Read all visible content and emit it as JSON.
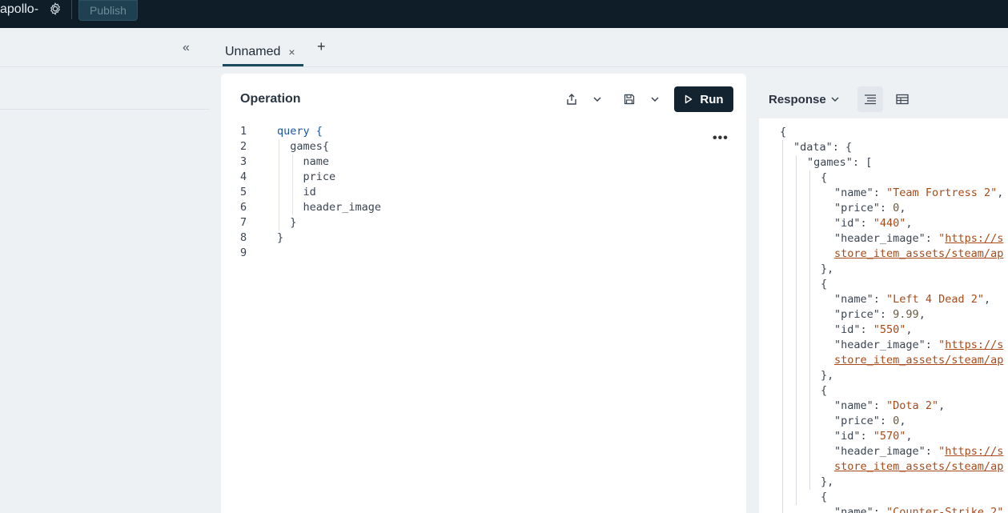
{
  "topbar": {
    "graph_name": "apollo-",
    "publish_label": "Publish"
  },
  "tabs": [
    {
      "label": "Unnamed",
      "close": "×"
    }
  ],
  "tab_add": "+",
  "sidebar": {
    "collapse_glyph": "«"
  },
  "operation": {
    "title": "Operation",
    "run_label": "Run",
    "lines": [
      {
        "n": "1",
        "text": "query {"
      },
      {
        "n": "2",
        "text": "  games{"
      },
      {
        "n": "3",
        "text": "    name"
      },
      {
        "n": "4",
        "text": "    price"
      },
      {
        "n": "5",
        "text": "    id"
      },
      {
        "n": "6",
        "text": "    header_image"
      },
      {
        "n": "7",
        "text": "  }"
      },
      {
        "n": "8",
        "text": "}"
      },
      {
        "n": "9",
        "text": ""
      }
    ],
    "more_glyph": "•••"
  },
  "response": {
    "title": "Response",
    "lines": [
      {
        "indent": 0,
        "parts": [
          {
            "t": "{",
            "c": "p"
          }
        ]
      },
      {
        "indent": 1,
        "parts": [
          {
            "t": "\"data\"",
            "c": "p"
          },
          {
            "t": ": {",
            "c": "p"
          }
        ]
      },
      {
        "indent": 2,
        "parts": [
          {
            "t": "\"games\"",
            "c": "p"
          },
          {
            "t": ": [",
            "c": "p"
          }
        ]
      },
      {
        "indent": 3,
        "parts": [
          {
            "t": "{",
            "c": "p"
          }
        ]
      },
      {
        "indent": 4,
        "parts": [
          {
            "t": "\"name\"",
            "c": "p"
          },
          {
            "t": ": ",
            "c": "p"
          },
          {
            "t": "\"Team Fortress 2\"",
            "c": "s"
          },
          {
            "t": ",",
            "c": "p"
          }
        ]
      },
      {
        "indent": 4,
        "parts": [
          {
            "t": "\"price\"",
            "c": "p"
          },
          {
            "t": ": ",
            "c": "p"
          },
          {
            "t": "0",
            "c": "n"
          },
          {
            "t": ",",
            "c": "p"
          }
        ]
      },
      {
        "indent": 4,
        "parts": [
          {
            "t": "\"id\"",
            "c": "p"
          },
          {
            "t": ": ",
            "c": "p"
          },
          {
            "t": "\"440\"",
            "c": "s"
          },
          {
            "t": ",",
            "c": "p"
          }
        ]
      },
      {
        "indent": 4,
        "parts": [
          {
            "t": "\"header_image\"",
            "c": "p"
          },
          {
            "t": ": ",
            "c": "p"
          },
          {
            "t": "\"",
            "c": "s"
          },
          {
            "t": "https://s",
            "c": "l"
          }
        ]
      },
      {
        "indent": 4,
        "parts": [
          {
            "t": "store_item_assets/steam/ap",
            "c": "l"
          }
        ]
      },
      {
        "indent": 3,
        "parts": [
          {
            "t": "},",
            "c": "p"
          }
        ]
      },
      {
        "indent": 3,
        "parts": [
          {
            "t": "{",
            "c": "p"
          }
        ]
      },
      {
        "indent": 4,
        "parts": [
          {
            "t": "\"name\"",
            "c": "p"
          },
          {
            "t": ": ",
            "c": "p"
          },
          {
            "t": "\"Left 4 Dead 2\"",
            "c": "s"
          },
          {
            "t": ",",
            "c": "p"
          }
        ]
      },
      {
        "indent": 4,
        "parts": [
          {
            "t": "\"price\"",
            "c": "p"
          },
          {
            "t": ": ",
            "c": "p"
          },
          {
            "t": "9.99",
            "c": "n"
          },
          {
            "t": ",",
            "c": "p"
          }
        ]
      },
      {
        "indent": 4,
        "parts": [
          {
            "t": "\"id\"",
            "c": "p"
          },
          {
            "t": ": ",
            "c": "p"
          },
          {
            "t": "\"550\"",
            "c": "s"
          },
          {
            "t": ",",
            "c": "p"
          }
        ]
      },
      {
        "indent": 4,
        "parts": [
          {
            "t": "\"header_image\"",
            "c": "p"
          },
          {
            "t": ": ",
            "c": "p"
          },
          {
            "t": "\"",
            "c": "s"
          },
          {
            "t": "https://s",
            "c": "l"
          }
        ]
      },
      {
        "indent": 4,
        "parts": [
          {
            "t": "store_item_assets/steam/ap",
            "c": "l"
          }
        ]
      },
      {
        "indent": 3,
        "parts": [
          {
            "t": "},",
            "c": "p"
          }
        ]
      },
      {
        "indent": 3,
        "parts": [
          {
            "t": "{",
            "c": "p"
          }
        ]
      },
      {
        "indent": 4,
        "parts": [
          {
            "t": "\"name\"",
            "c": "p"
          },
          {
            "t": ": ",
            "c": "p"
          },
          {
            "t": "\"Dota 2\"",
            "c": "s"
          },
          {
            "t": ",",
            "c": "p"
          }
        ]
      },
      {
        "indent": 4,
        "parts": [
          {
            "t": "\"price\"",
            "c": "p"
          },
          {
            "t": ": ",
            "c": "p"
          },
          {
            "t": "0",
            "c": "n"
          },
          {
            "t": ",",
            "c": "p"
          }
        ]
      },
      {
        "indent": 4,
        "parts": [
          {
            "t": "\"id\"",
            "c": "p"
          },
          {
            "t": ": ",
            "c": "p"
          },
          {
            "t": "\"570\"",
            "c": "s"
          },
          {
            "t": ",",
            "c": "p"
          }
        ]
      },
      {
        "indent": 4,
        "parts": [
          {
            "t": "\"header_image\"",
            "c": "p"
          },
          {
            "t": ": ",
            "c": "p"
          },
          {
            "t": "\"",
            "c": "s"
          },
          {
            "t": "https://s",
            "c": "l"
          }
        ]
      },
      {
        "indent": 4,
        "parts": [
          {
            "t": "store_item_assets/steam/ap",
            "c": "l"
          }
        ]
      },
      {
        "indent": 3,
        "parts": [
          {
            "t": "},",
            "c": "p"
          }
        ]
      },
      {
        "indent": 3,
        "parts": [
          {
            "t": "{",
            "c": "p"
          }
        ]
      },
      {
        "indent": 4,
        "parts": [
          {
            "t": "\"name\"",
            "c": "p"
          },
          {
            "t": ": ",
            "c": "p"
          },
          {
            "t": "\"Counter-Strike 2\"",
            "c": "s"
          }
        ]
      }
    ]
  },
  "colors": {
    "topbar_bg": "#0e1d28",
    "run_bg": "#13232f",
    "tab_underline": "#1b4a5c",
    "keyword": "#1b55a8",
    "string": "#a84a1a"
  }
}
